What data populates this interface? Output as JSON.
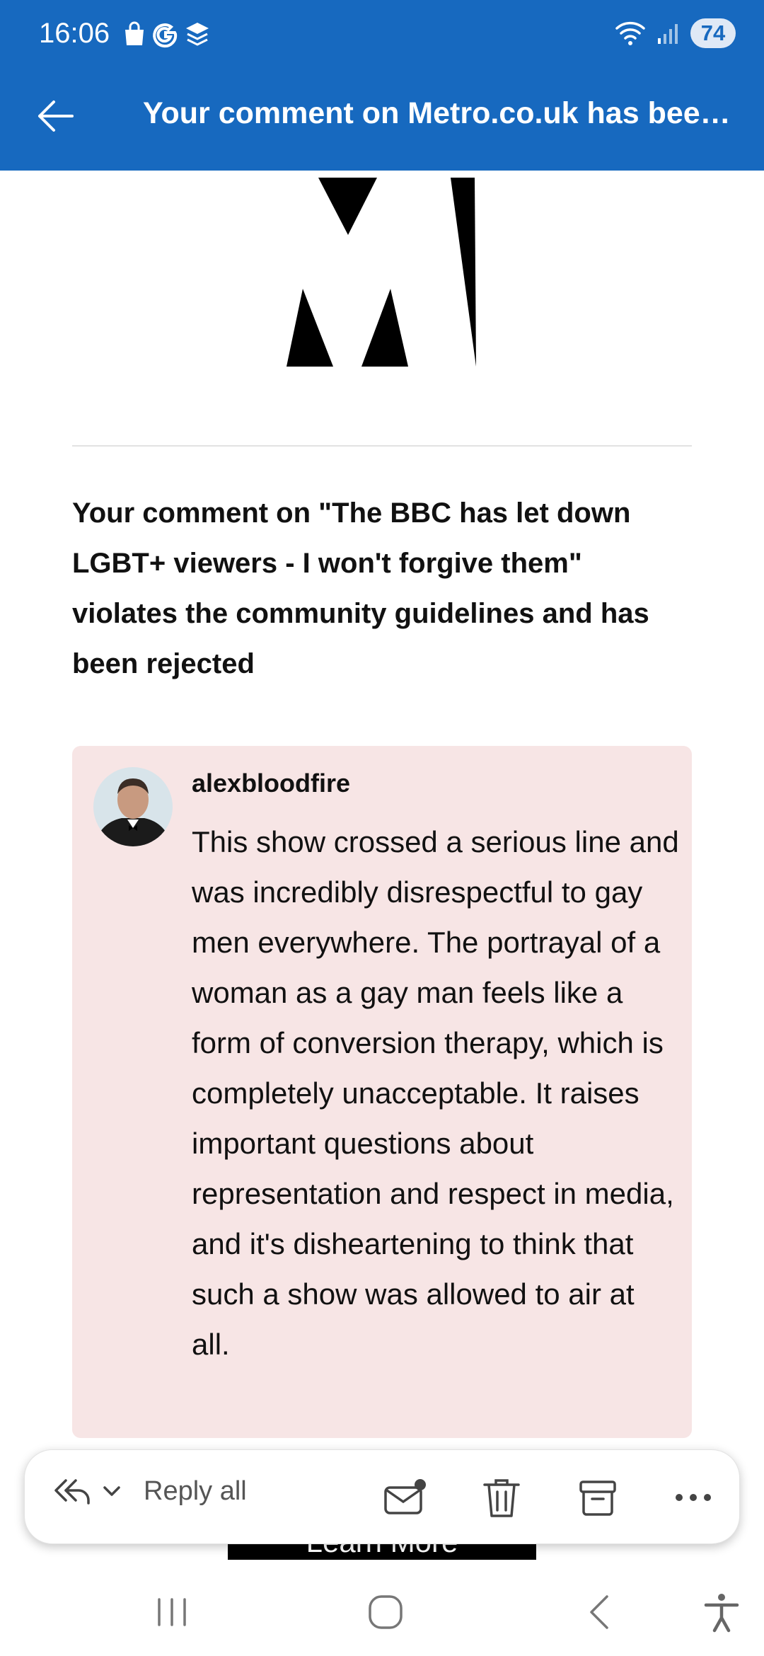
{
  "status_bar": {
    "time": "16:06",
    "battery": "74"
  },
  "app_bar": {
    "title": "Your comment on Metro.co.uk has been..."
  },
  "email": {
    "headline": "Your comment on \"The BBC has let down LGBT+ viewers - I won't forgive them\" violates the community guidelines and has been rejected",
    "comment": {
      "username": "alexbloodfire",
      "text": "This show crossed a serious line and was incredibly disrespectful to gay men everywhere. The portrayal of a woman as a gay man feels like a form of conversion therapy, which is completely unacceptable. It raises important questions about representation and respect in media, and it's disheartening to think that such a show was allowed to air at all."
    },
    "cta_label": "Learn More"
  },
  "action_bar": {
    "reply_label": "Reply all",
    "icons": [
      "reply-all-icon",
      "chevron-down-icon",
      "mark-unread-icon",
      "delete-icon",
      "archive-icon",
      "more-icon"
    ]
  },
  "colors": {
    "header_blue": "#1769bf",
    "comment_bg": "#f7e5e5"
  }
}
